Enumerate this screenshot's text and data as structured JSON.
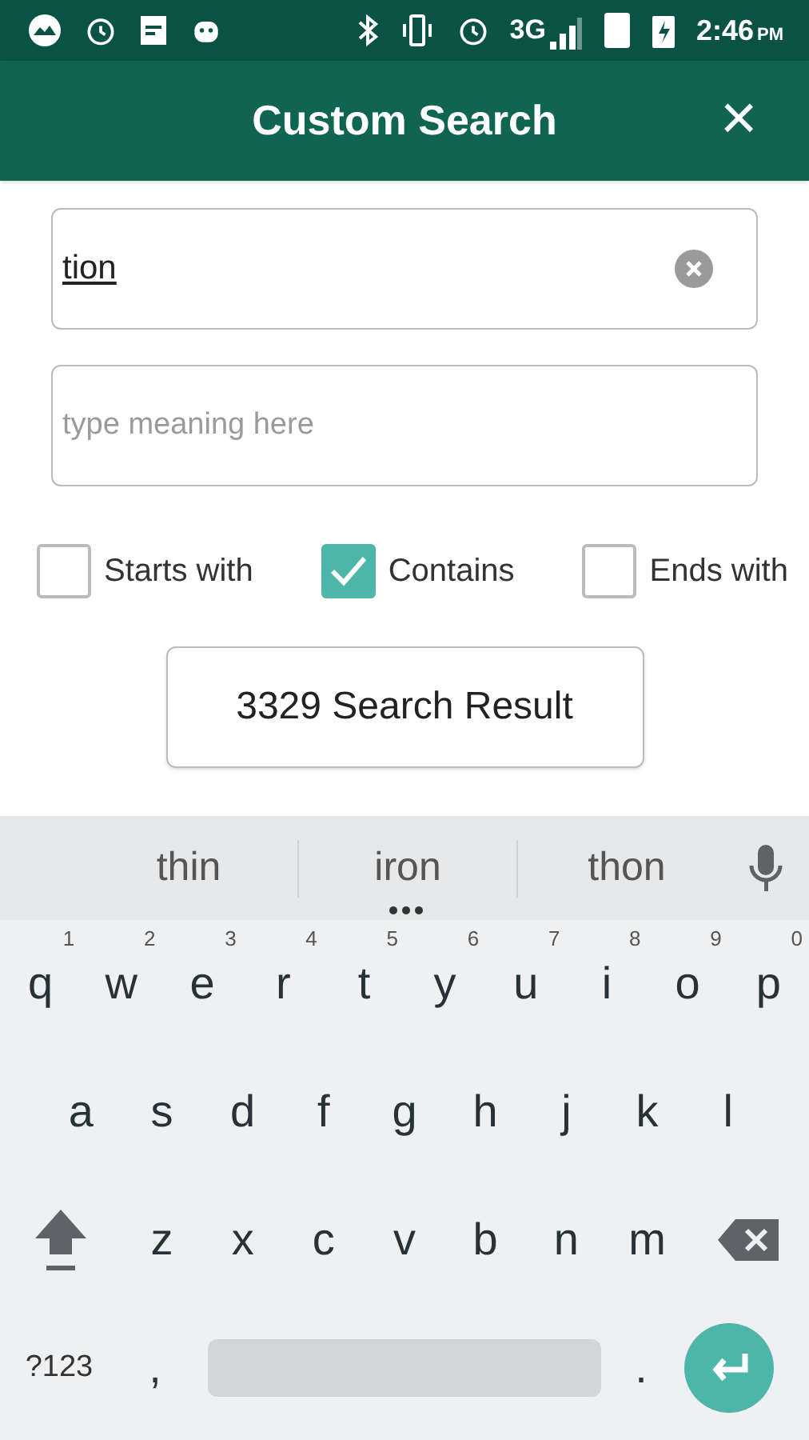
{
  "status_bar": {
    "time": "2:46",
    "ampm": "PM",
    "network": "3G"
  },
  "app_bar": {
    "title": "Custom Search",
    "close": "×"
  },
  "word_field": {
    "value": "tion"
  },
  "meaning_field": {
    "placeholder": "type meaning here"
  },
  "options": [
    {
      "label": "Starts with",
      "checked": false
    },
    {
      "label": "Contains",
      "checked": true
    },
    {
      "label": "Ends with",
      "checked": false
    }
  ],
  "result_button": {
    "label": "3329 Search Result"
  },
  "keyboard": {
    "suggestions": [
      "thin",
      "iron",
      "thon"
    ],
    "rows": [
      [
        {
          "label": "q",
          "hint": "1"
        },
        {
          "label": "w",
          "hint": "2"
        },
        {
          "label": "e",
          "hint": "3"
        },
        {
          "label": "r",
          "hint": "4"
        },
        {
          "label": "t",
          "hint": "5"
        },
        {
          "label": "y",
          "hint": "6"
        },
        {
          "label": "u",
          "hint": "7"
        },
        {
          "label": "i",
          "hint": "8"
        },
        {
          "label": "o",
          "hint": "9"
        },
        {
          "label": "p",
          "hint": "0"
        }
      ],
      [
        {
          "label": "a"
        },
        {
          "label": "s"
        },
        {
          "label": "d"
        },
        {
          "label": "f"
        },
        {
          "label": "g"
        },
        {
          "label": "h"
        },
        {
          "label": "j"
        },
        {
          "label": "k"
        },
        {
          "label": "l"
        }
      ],
      [
        {
          "label": "z"
        },
        {
          "label": "x"
        },
        {
          "label": "c"
        },
        {
          "label": "v"
        },
        {
          "label": "b"
        },
        {
          "label": "n"
        },
        {
          "label": "m"
        }
      ]
    ],
    "symbols_key": "?123",
    "comma_key": ",",
    "period_key": "."
  }
}
